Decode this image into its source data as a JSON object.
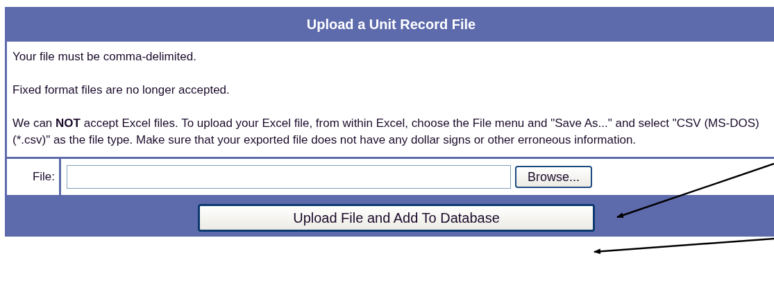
{
  "title": "Upload a Unit Record File",
  "paragraphs": [
    "Your file must be comma-delimited.",
    "Fixed format files are no longer accepted.",
    "We can **NOT** accept Excel files. To upload your Excel file, from within Excel, choose the File menu and \"Save As...\" and select \"CSV (MS-DOS) (*.csv)\" as the file type. Make sure that your exported file does not have any dollar signs or other erroneous information."
  ],
  "file_field": {
    "label": "File:",
    "browse_button": "Browse..."
  },
  "submit_button": "Upload File and Add To Database"
}
